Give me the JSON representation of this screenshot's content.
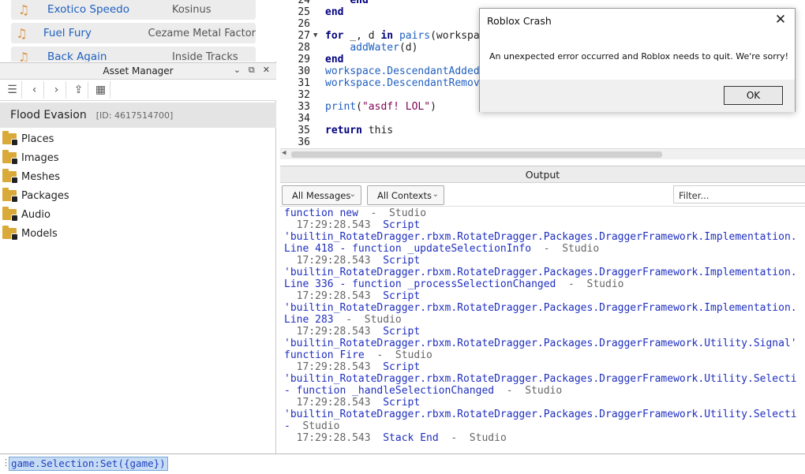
{
  "audio_list": [
    {
      "name": "Exotico Speedo",
      "artist": "Kosinus"
    },
    {
      "name": "Fuel Fury",
      "artist": "Cezame Metal Factor"
    },
    {
      "name": "Back Again",
      "artist": "Inside Tracks"
    }
  ],
  "asset_manager": {
    "title": "Asset Manager",
    "game_name": "Flood Evasion",
    "game_id": "[ID: 4617514700]",
    "folders": [
      "Places",
      "Images",
      "Meshes",
      "Packages",
      "Audio",
      "Models"
    ]
  },
  "editor": {
    "line_numbers": [
      "24",
      "25",
      "26",
      "27",
      "28",
      "29",
      "30",
      "31",
      "32",
      "33",
      "34",
      "35",
      "36"
    ]
  },
  "output": {
    "title": "Output",
    "messages_filter": "All Messages",
    "contexts_filter": "All Contexts",
    "filter_placeholder": "Filter...",
    "lines": [
      {
        "t": "function new",
        "s": "  -  Studio"
      },
      {
        "ts": "  17:29:28.543",
        "k": "  Script"
      },
      {
        "t": "'builtin_RotateDragger.rbxm.RotateDragger.Packages.DraggerFramework.Implementation.",
        "s": ""
      },
      {
        "t": "Line 418 - function _updateSelectionInfo",
        "s": "  -  Studio"
      },
      {
        "ts": "  17:29:28.543",
        "k": "  Script"
      },
      {
        "t": "'builtin_RotateDragger.rbxm.RotateDragger.Packages.DraggerFramework.Implementation.",
        "s": ""
      },
      {
        "t": "Line 336 - function _processSelectionChanged",
        "s": "  -  Studio"
      },
      {
        "ts": "  17:29:28.543",
        "k": "  Script"
      },
      {
        "t": "'builtin_RotateDragger.rbxm.RotateDragger.Packages.DraggerFramework.Implementation.",
        "s": ""
      },
      {
        "t": "Line 283",
        "s": "  -  Studio"
      },
      {
        "ts": "  17:29:28.543",
        "k": "  Script"
      },
      {
        "t": "'builtin_RotateDragger.rbxm.RotateDragger.Packages.DraggerFramework.Utility.Signal'",
        "s": ""
      },
      {
        "t": "function Fire",
        "s": "  -  Studio"
      },
      {
        "ts": "  17:29:28.543",
        "k": "  Script"
      },
      {
        "t": "'builtin_RotateDragger.rbxm.RotateDragger.Packages.DraggerFramework.Utility.Selecti",
        "s": ""
      },
      {
        "t": "- function _handleSelectionChanged",
        "s": "  -  Studio"
      },
      {
        "ts": "  17:29:28.543",
        "k": "  Script"
      },
      {
        "t": "'builtin_RotateDragger.rbxm.RotateDragger.Packages.DraggerFramework.Utility.Selecti",
        "s": ""
      },
      {
        "t": "-",
        "s": "  Studio"
      },
      {
        "ts": "  17:29:28.543",
        "k": "  Stack End",
        "s": "  -  Studio"
      }
    ]
  },
  "command_bar": {
    "value": "game.Selection:Set({game})"
  },
  "dialog": {
    "title": "Roblox Crash",
    "message": "An unexpected error occurred and Roblox needs to quit.  We're sorry!",
    "ok_label": "OK"
  }
}
